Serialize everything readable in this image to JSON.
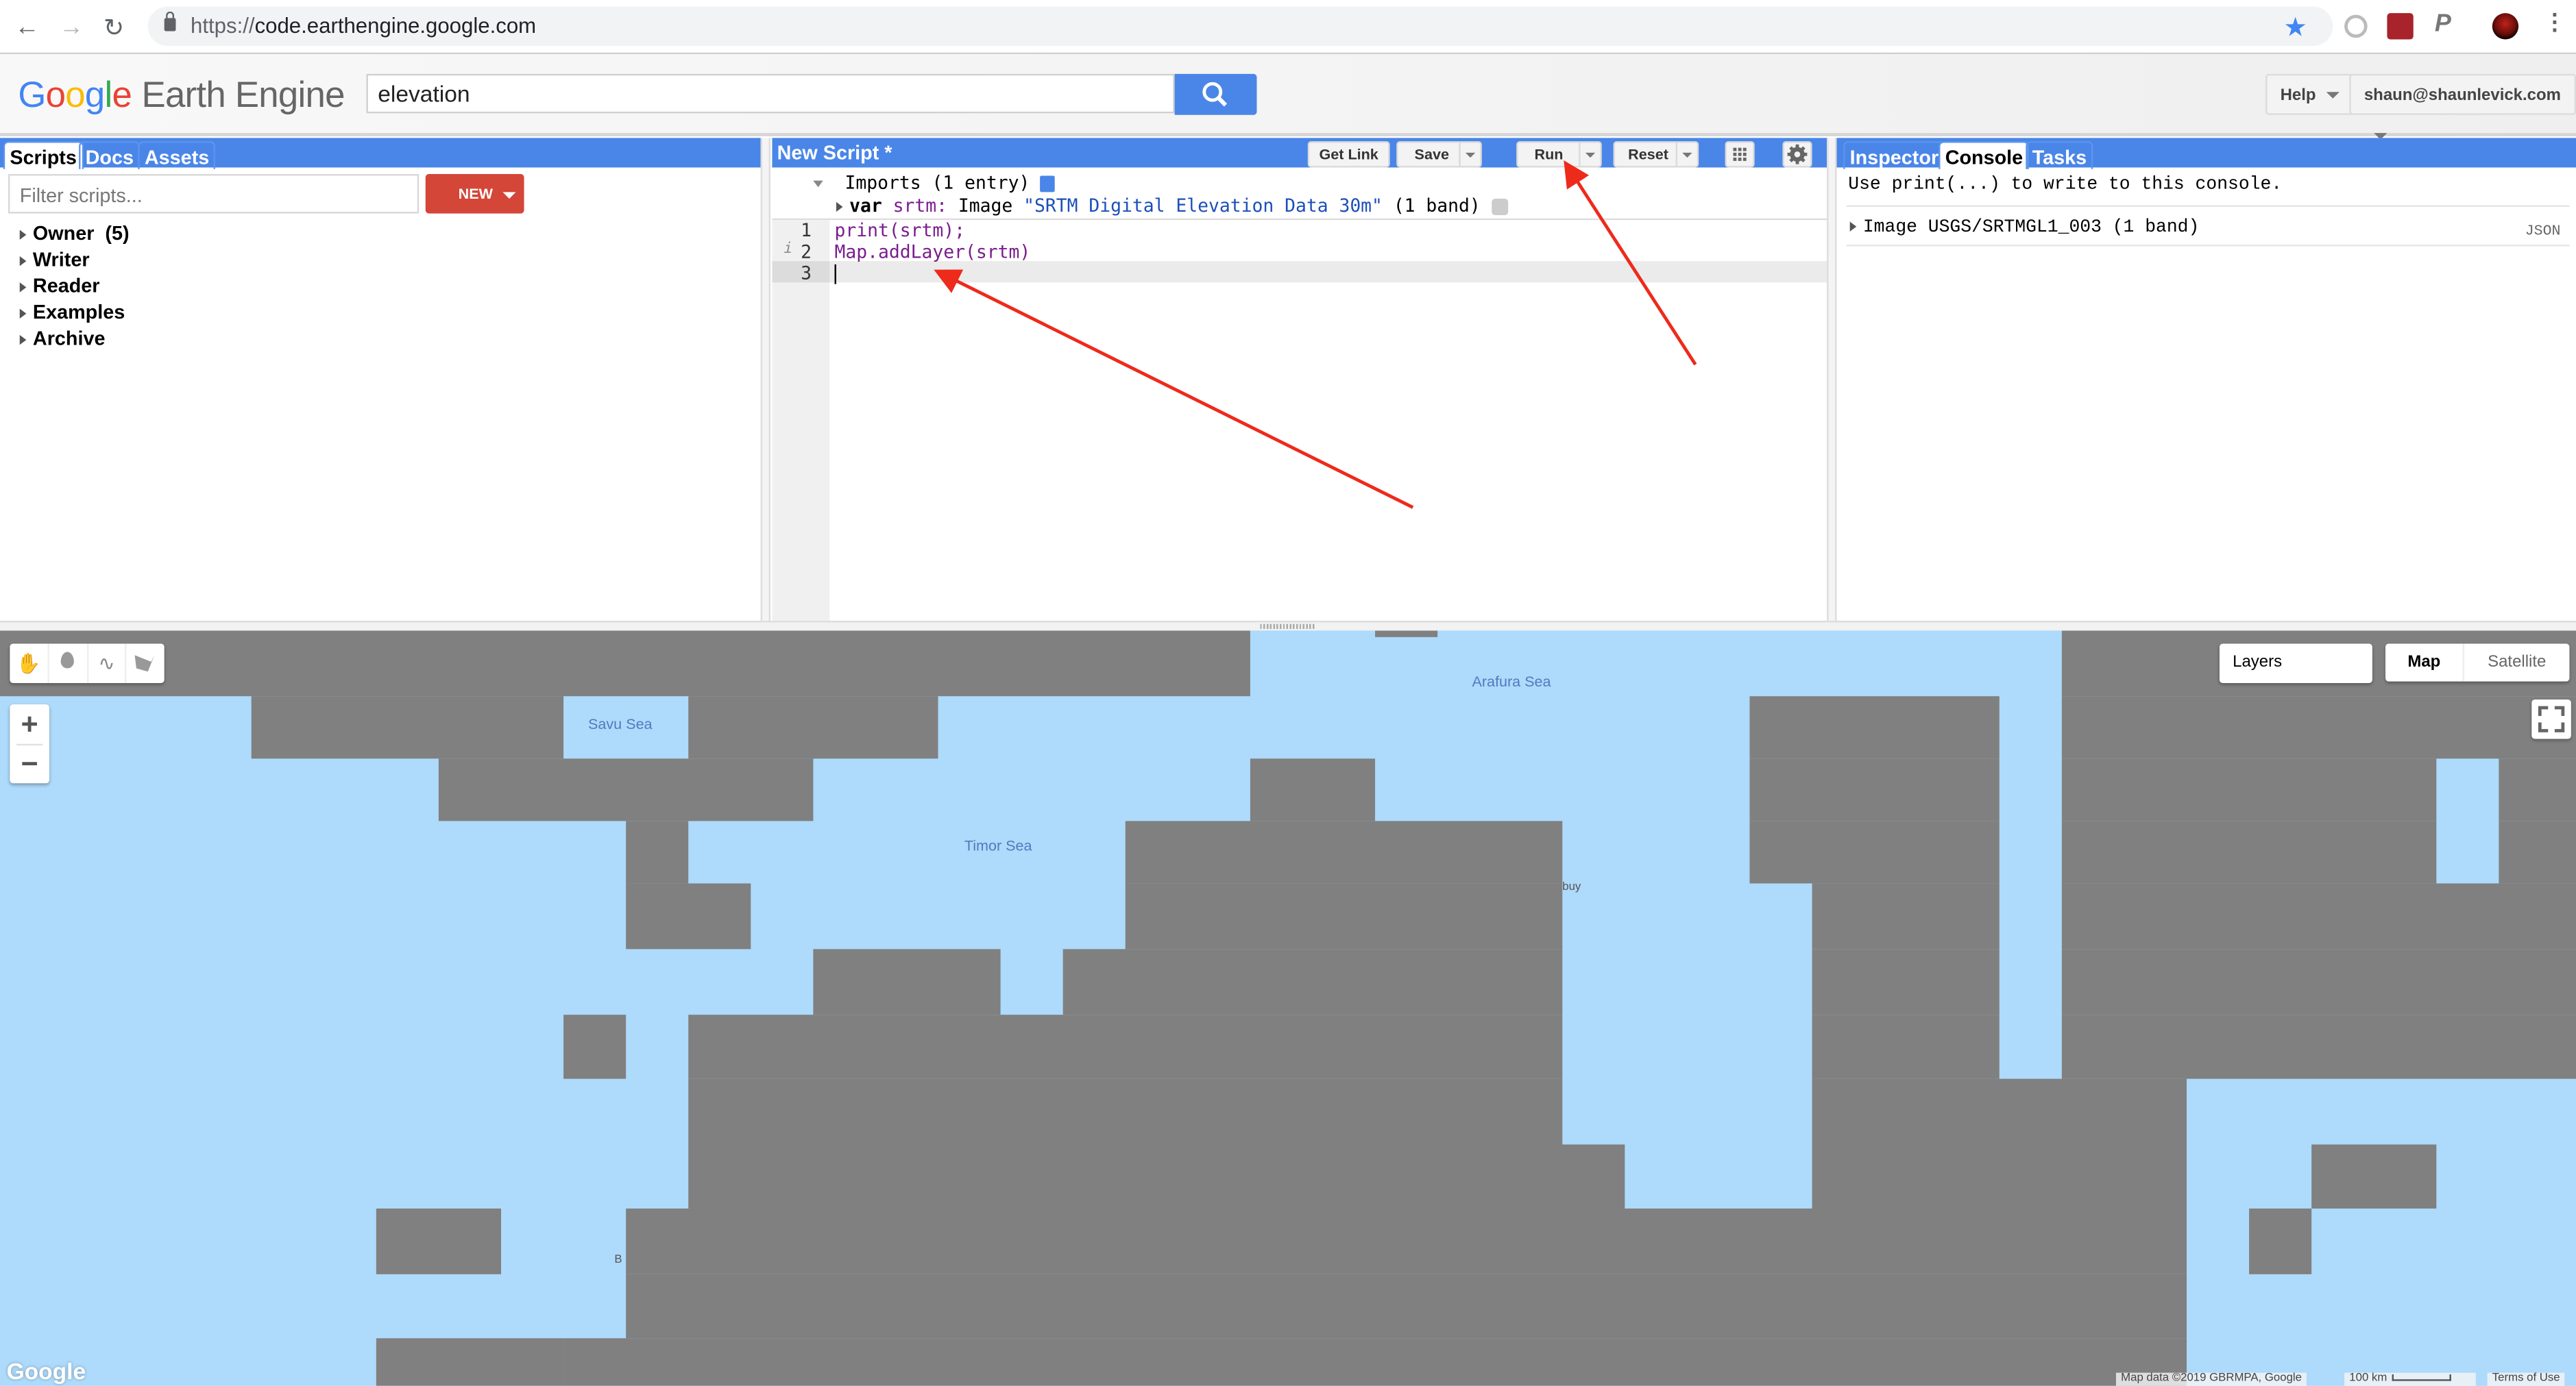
{
  "browser": {
    "url_scheme": "https://",
    "url_host": "code.earthengine.google.com",
    "icons": [
      "back-icon",
      "forward-icon",
      "reload-icon",
      "lock-icon",
      "bookmark-star-icon",
      "extension-circle-icon",
      "mendeley-extension-icon",
      "p-extension-icon",
      "profile-avatar",
      "chrome-menu-icon"
    ]
  },
  "app": {
    "logo_google": [
      "G",
      "o",
      "o",
      "g",
      "l",
      "e"
    ],
    "logo_product": "Earth Engine",
    "search_value": "elevation",
    "help_label": "Help",
    "account_label": "shaun@shaunlevick.com"
  },
  "left_panel": {
    "tabs": [
      {
        "label": "Scripts",
        "active": true
      },
      {
        "label": "Docs",
        "active": false
      },
      {
        "label": "Assets",
        "active": false
      }
    ],
    "filter_placeholder": "Filter scripts...",
    "new_button": "NEW",
    "tree": [
      {
        "label": "Owner  (5)"
      },
      {
        "label": "Writer"
      },
      {
        "label": "Reader"
      },
      {
        "label": "Examples"
      },
      {
        "label": "Archive"
      }
    ]
  },
  "editor": {
    "title": "New Script *",
    "buttons": {
      "get_link": "Get Link",
      "save": "Save",
      "run": "Run",
      "reset": "Reset"
    },
    "imports_header": "Imports (1 entry)",
    "import_line": {
      "keyword": "var",
      "name": "srtm:",
      "type": "Image",
      "string": "\"SRTM Digital Elevation Data 30m\"",
      "suffix": "(1 band)"
    },
    "lines": [
      {
        "number": "1",
        "code": "print(srtm);",
        "info": false
      },
      {
        "number": "2",
        "code": "Map.addLayer(srtm)",
        "info": true
      },
      {
        "number": "3",
        "code": "",
        "info": false
      }
    ],
    "info_marker": "i"
  },
  "right_panel": {
    "tabs": [
      {
        "label": "Inspector",
        "active": false
      },
      {
        "label": "Console",
        "active": true
      },
      {
        "label": "Tasks",
        "active": false
      }
    ],
    "console_hint": "Use print(...) to write to this console.",
    "console_entry": "Image USGS/SRTMGL1_003 (1 band)",
    "json_link": "JSON"
  },
  "map": {
    "layers_label": "Layers",
    "map_type_options": [
      {
        "label": "Map",
        "selected": true
      },
      {
        "label": "Satellite",
        "selected": false
      }
    ],
    "zoom_in": "+",
    "zoom_out": "−",
    "drawing_tools": [
      "hand-pan-icon",
      "point-marker-icon",
      "line-icon",
      "polygon-icon"
    ],
    "place_labels": [
      {
        "name": "Savu Sea"
      },
      {
        "name": "Timor Sea"
      },
      {
        "name": "Arafura Sea"
      },
      {
        "name": "buy"
      },
      {
        "name": "B"
      }
    ],
    "attribution": "Map data ©2019 GBRMPA, Google",
    "scale_label": "100 km",
    "terms": "Terms of Use",
    "google_watermark": "Google",
    "colors": {
      "land": "#808080",
      "water": "#aedafb",
      "label": "#4f7ac0"
    }
  },
  "annotations": {
    "arrow_color": "#ee2a1b",
    "arrows": [
      "arrow-to-code-line-3",
      "arrow-to-run-button"
    ]
  },
  "colors": {
    "panel_header": "#4a86e8",
    "new_button": "#d44638",
    "search_button": "#4a86e8"
  }
}
